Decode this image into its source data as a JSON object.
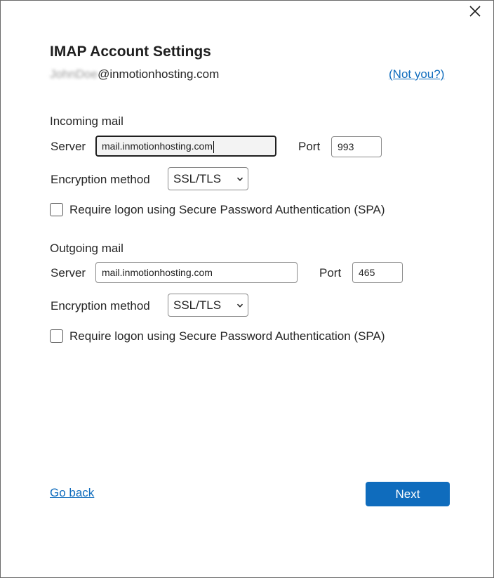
{
  "dialog": {
    "title": "IMAP Account Settings",
    "email_username": "JohnDoe",
    "email_domain": "@inmotionhosting.com",
    "not_you": "(Not you?)"
  },
  "incoming": {
    "heading": "Incoming mail",
    "server_label": "Server",
    "server_value": "mail.inmotionhosting.com",
    "port_label": "Port",
    "port_value": "993",
    "encryption_label": "Encryption method",
    "encryption_value": "SSL/TLS",
    "spa_label": "Require logon using Secure Password Authentication (SPA)",
    "spa_checked": false
  },
  "outgoing": {
    "heading": "Outgoing mail",
    "server_label": "Server",
    "server_value": "mail.inmotionhosting.com",
    "port_label": "Port",
    "port_value": "465",
    "encryption_label": "Encryption method",
    "encryption_value": "SSL/TLS",
    "spa_label": "Require logon using Secure Password Authentication (SPA)",
    "spa_checked": false
  },
  "footer": {
    "go_back": "Go back",
    "next": "Next"
  },
  "colors": {
    "accent": "#0f6cbd",
    "text": "#262626",
    "border": "#8a8a8a"
  },
  "icons": {
    "close": "close-icon",
    "dropdown": "chevron-down-icon"
  }
}
